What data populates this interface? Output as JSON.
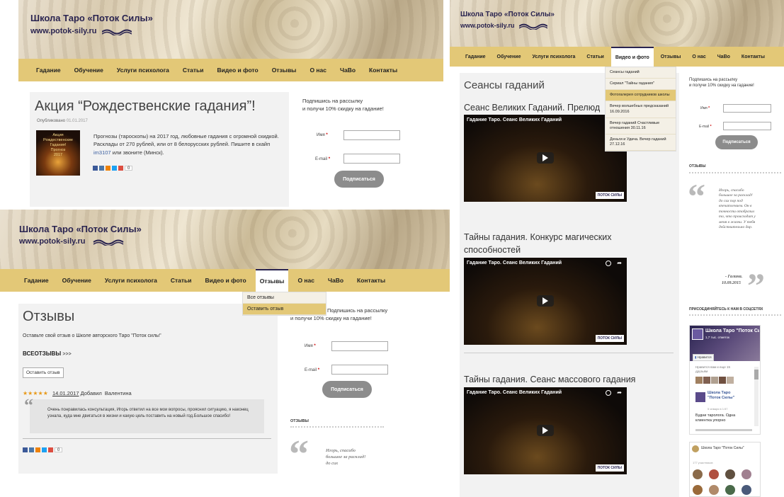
{
  "site": {
    "title": "Школа Таро «Поток Силы»",
    "url": "www.potok-sily.ru"
  },
  "nav": {
    "items": [
      "Гадание",
      "Обучение",
      "Услуги психолога",
      "Статьи",
      "Видео и фото",
      "Отзывы",
      "О нас",
      "ЧаВо",
      "Контакты"
    ]
  },
  "subscribe": {
    "line1": "Подпишись на рассылку",
    "line2": "и получи 10% скидку на гадание!",
    "name_label": "Имя",
    "email_label": "E-mail",
    "button": "Подписаться"
  },
  "panel1": {
    "title": "Акция “Рождественские гадания”!",
    "meta_label": "Опубликовано",
    "meta_date": "01.01.2017",
    "body": "Прогнозы (тароскопы) на 2017 год, любовные гадания с огромной скидкой. Расклады от 270 рублей, или от 8 белорусских рублей. Пишите в скайп",
    "skype": "im3107",
    "body_end": "или звоните (Минск).",
    "thumb_lines": [
      "Акция",
      "Рождественские",
      "Гадания!",
      "Прогноз",
      "2017"
    ],
    "share_count": "0"
  },
  "panel2": {
    "title": "Отзывы",
    "intro": "Оставьте свой отзыв о Школе авторского Таро \"Поток силы\"",
    "all_reviews": "ВСЕОТЗЫВЫ",
    "all_reviews_arrows": ">>>",
    "leave_button": "Оставить отзыв",
    "review_date": "14.01.2017",
    "review_added": "Добавил",
    "review_author": "Валентина",
    "review_text": "Очень понравилась консультация, Игорь ответил на все мои вопросы, прояснил ситуацию, я наконец узнала, куда мне двигаться в жизни и какую цель поставить на новый год.Большое спасибо!",
    "share_count": "0",
    "dropdown": [
      "Все отзывы",
      "Оставить отзыв"
    ],
    "side_heading": "ОТЗЫВЫ",
    "side_quote": "Игорь, спасибо большое за расклад! до сих"
  },
  "panel3": {
    "title": "Сеансы гаданий",
    "sections": [
      {
        "heading": "Сеанс Великих Гаданий. Прелюд",
        "video_title": "Гадание Таро. Сеанс Великих Гаданий"
      },
      {
        "heading": "Тайны гадания. Конкурс магических способностей",
        "video_title": "Гадание Таро. Сеанс Великих Гаданий"
      },
      {
        "heading": "Тайны гадания. Сеанс массового гадания",
        "video_title": "Гадание Таро. Сеанс Великих Гаданий"
      }
    ],
    "video_brand": "ПОТОК СИЛЫ",
    "dropdown": [
      "Сеансы гаданий",
      "Сериал \"Тайны гадания\"",
      "Фотогалерея сотрудников школы",
      "Вечер волшебных предсказаний 16.09.2016",
      "Вечер гаданий Счастливые отношения 30.11.16",
      "Деньги и Удача. Вечер гаданий 27.12.16"
    ],
    "side_heading": "ОТЗЫВЫ",
    "side_quote": "Игорь, спасибо большое за расклад! до сих пор под впечатлением. Он в точности отобразил то, что происходит у меня в жизни. У тебя действительно дар.",
    "side_quote_author": "- Галина.",
    "side_quote_date": "10.09.2015",
    "social_heading": "ПРИСОЕДИНЯЙТЕСЬ К НАМ В СОЦСЕТЯХ",
    "fb_title": "Школа Таро \"Поток Силы\"",
    "fb_likes": "1,7 тыс. отметок",
    "fb_like_btn": "Нравится",
    "fb_friends": "Нравится вам и еще 15 друзьям",
    "fb_post_title": "Школа Таро \"Поток Силы\"",
    "fb_post_date": "5 января в 1:57",
    "fb_post_text": "Будни таролога. Одна клиентка упорно",
    "vk_title": "Школа Таро \"Поток Силы\"",
    "vk_members": "177 участников"
  }
}
